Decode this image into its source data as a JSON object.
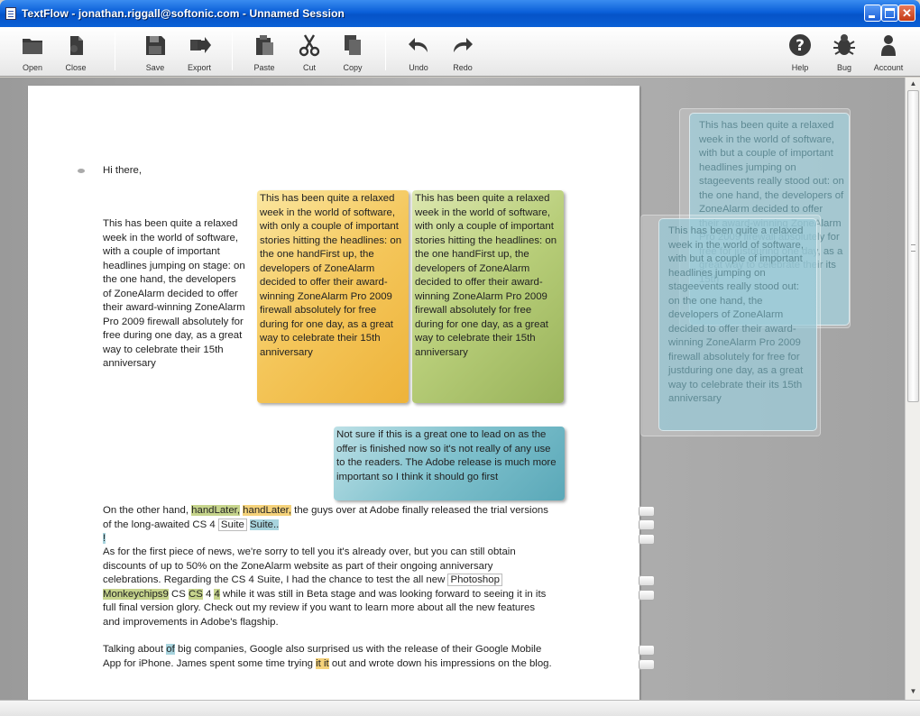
{
  "window": {
    "title": "TextFlow - jonathan.riggall@softonic.com - Unnamed Session",
    "min_glyph": "_",
    "max_glyph": "□",
    "close_glyph": "✕"
  },
  "toolbar": {
    "open": "Open",
    "close": "Close",
    "save": "Save",
    "export": "Export",
    "paste": "Paste",
    "cut": "Cut",
    "copy": "Copy",
    "undo": "Undo",
    "redo": "Redo",
    "help": "Help",
    "bug": "Bug",
    "account": "Account"
  },
  "doc": {
    "greeting": "Hi there,",
    "para1": "This has been quite a relaxed week in the world of software, with a couple of important headlines jumping on stage: on the one hand, the developers of ZoneAlarm decided to offer their award-winning ZoneAlarm Pro 2009 firewall absolutely for free during one day, as a great way to celebrate their 15th anniversary",
    "note_yellow": "This has been quite a relaxed week in the world of software, with only a couple of important stories hitting the headlines: on the one handFirst up, the developers of ZoneAlarm decided to offer their award-winning ZoneAlarm Pro 2009 firewall absolutely for free during for one day, as a great way to celebrate their 15th anniversary",
    "note_green": "This has been quite a relaxed week in the world of software, with only a couple of important stories hitting the headlines: on the one handFirst up, the developers of ZoneAlarm decided to offer their award-winning ZoneAlarm Pro 2009 firewall absolutely for free during for one day, as a great way to celebrate their 15th anniversary",
    "note_blue": "Not sure if this is a great one to lead on as the offer is finished now so it's not really of any use to the readers. The Adobe release is much more important so I think it should go first",
    "p2_a": "On the other hand, ",
    "p2_hl1": "handLater,",
    "p2_hl2": "handLater,",
    "p2_b": " the guys over at Adobe finally released the trial versions of the long-awaited CS 4 ",
    "p2_suite": "Suite",
    "p2_c": " ",
    "p2_suite2": "Suite..",
    "p2_mark": "!",
    "p3_a": "As for the first piece of news, we're sorry to tell you it's already over, but you can still obtain discounts of up to 50% on the ZoneAlarm website as part of their ongoing anniversary celebrations. Regarding the CS 4 Suite, I had the chance to test the all new ",
    "p3_photoshop": "Photoshop",
    "p3_monkey": "Monkeychips9",
    "p3_b": " CS ",
    "p3_cs": "CS",
    "p3_c": " 4 ",
    "p3_4": "4",
    "p3_d": " while it was still in Beta stage and was looking forward to seeing it in its full final version glory. Check out my review if you want to learn more about all the new features and improvements in Adobe's flagship.",
    "p4_a": "Talking about ",
    "p4_of": "of",
    "p4_b": " big companies, Google also surprised us with the release of their Google Mobile App for iPhone. James spent some time trying ",
    "p4_itit": "it it",
    "p4_c": " out and wrote down his impressions on the blog."
  },
  "ghosts": {
    "back": "This has been quite a relaxed week in the world of software, with but a couple of important headlines jumping on stageevents really stood out: on the one hand, the developers of ZoneAlarm decided to offer their award-winning ZoneAlarm Pro 2009 firewall absolutely for free for justduring one day, as a great way to celebrate their its 15th",
    "front": "This has been quite a relaxed week in the world of software, with but a couple of important headlines jumping on stageevents really stood out: on the one hand, the developers of ZoneAlarm decided to offer their award-winning ZoneAlarm Pro 2009 firewall absolutely for free for justduring one day, as a great way to celebrate their its 15th anniversary"
  }
}
